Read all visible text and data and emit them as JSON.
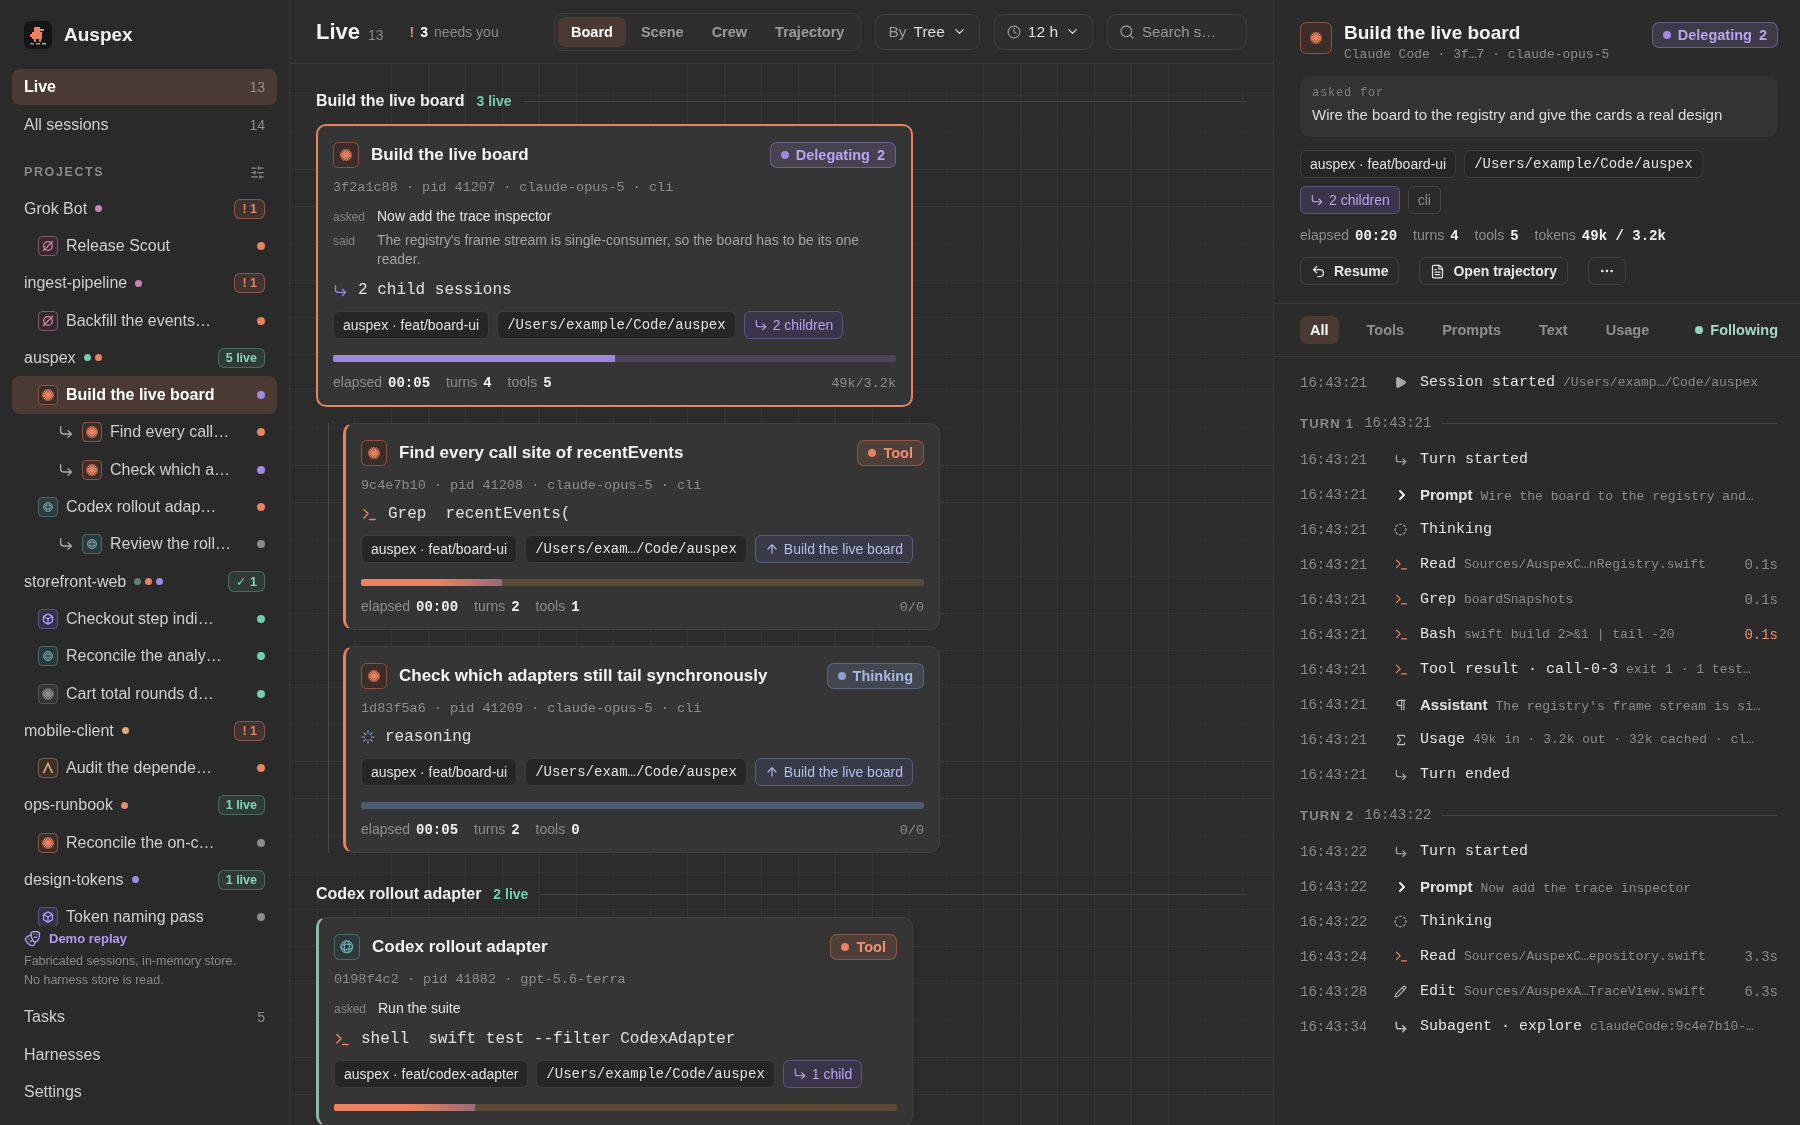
{
  "sidebar": {
    "app_name": "Auspex",
    "nav": [
      {
        "label": "Live",
        "count": "13",
        "selected": true
      },
      {
        "label": "All sessions",
        "count": "14",
        "selected": false
      }
    ],
    "projects_heading": "PROJECTS",
    "projects": [
      {
        "name": "Grok Bot",
        "dots": [
          {
            "color": "#c587b0"
          }
        ],
        "badge": {
          "kind": "alert",
          "text": "! 1"
        },
        "sessions": [
          {
            "title": "Release Scout",
            "kind": "grok",
            "color": "#e8825f",
            "selected": false
          }
        ]
      },
      {
        "name": "ingest-pipeline",
        "dots": [
          {
            "color": "#c587b0"
          }
        ],
        "badge": {
          "kind": "alert",
          "text": "! 1"
        },
        "sessions": [
          {
            "title": "Backfill the events…",
            "kind": "grok",
            "color": "#e8825f",
            "selected": false
          }
        ]
      },
      {
        "name": "auspex",
        "dots": [
          {
            "color": "#6fcfb0"
          },
          {
            "color": "#e8825f"
          }
        ],
        "badge": {
          "kind": "live",
          "text": "5 live"
        },
        "sessions": [
          {
            "title": "Build the live board",
            "kind": "claude",
            "color": "#a08ae0",
            "selected": true,
            "children": [
              {
                "title": "Find every call…",
                "kind": "claude",
                "color": "#e8825f",
                "selected": false
              },
              {
                "title": "Check which a…",
                "kind": "claude",
                "color": "#a08ae0",
                "selected": false
              }
            ]
          },
          {
            "title": "Codex rollout adap…",
            "kind": "codex",
            "color": "#e8825f",
            "selected": false,
            "children": [
              {
                "title": "Review the roll…",
                "kind": "codex",
                "color": "#8a8a8a",
                "selected": false
              }
            ]
          }
        ]
      },
      {
        "name": "storefront-web",
        "dots": [
          {
            "color": "#5f7f78"
          },
          {
            "color": "#e8825f"
          },
          {
            "color": "#a08ae0"
          }
        ],
        "badge": {
          "kind": "done",
          "text": "✓ 1"
        },
        "sessions": [
          {
            "title": "Checkout step indi…",
            "kind": "cube",
            "color": "#6fcfb0",
            "selected": false
          },
          {
            "title": "Reconcile the analy…",
            "kind": "codex",
            "color": "#6fcfb0",
            "selected": false
          },
          {
            "title": "Cart total rounds d…",
            "kind": "spark",
            "color": "#6fcfb0",
            "selected": false
          }
        ]
      },
      {
        "name": "mobile-client",
        "dots": [
          {
            "color": "#e0a878"
          }
        ],
        "badge": {
          "kind": "alert",
          "text": "! 1"
        },
        "sessions": [
          {
            "title": "Audit the depende…",
            "kind": "peak",
            "color": "#e8825f",
            "selected": false
          }
        ]
      },
      {
        "name": "ops-runbook",
        "dots": [
          {
            "color": "#e0906a"
          }
        ],
        "badge": {
          "kind": "live",
          "text": "1 live"
        },
        "sessions": [
          {
            "title": "Reconcile the on-c…",
            "kind": "claude",
            "color": "#8a8a8a",
            "selected": false
          }
        ]
      },
      {
        "name": "design-tokens",
        "dots": [
          {
            "color": "#a08ae0"
          }
        ],
        "badge": {
          "kind": "live",
          "text": "1 live"
        },
        "sessions": [
          {
            "title": "Token naming pass",
            "kind": "cube",
            "color": "#8a8a8a",
            "selected": false
          }
        ]
      }
    ],
    "demo": {
      "title": "Demo replay",
      "lines": [
        "Fabricated sessions, in-memory store.",
        "No harness store is read."
      ]
    },
    "footer": [
      {
        "label": "Tasks",
        "count": "5"
      },
      {
        "label": "Harnesses"
      },
      {
        "label": "Settings"
      }
    ]
  },
  "main": {
    "title": "Live",
    "count": "13",
    "attention": {
      "mark": "!",
      "count": "3",
      "label": "needs you"
    },
    "views": [
      {
        "label": "Board",
        "selected": true
      },
      {
        "label": "Scene",
        "selected": false
      },
      {
        "label": "Crew",
        "selected": false
      },
      {
        "label": "Trajectory",
        "selected": false
      }
    ],
    "group_by": {
      "label": "By",
      "value": "Tree"
    },
    "range": {
      "value": "12 h"
    },
    "search": {
      "placeholder": "Search s…"
    },
    "groups": [
      {
        "title": "Build the live board",
        "live": "3 live",
        "cards": [
          {
            "title": "Build the live board",
            "kind": "claude",
            "selected": true,
            "color": "#e8825f",
            "status": {
              "kind": "delegating",
              "label": "Delegating",
              "count": "2"
            },
            "meta": "3f2a1c88 · pid 41207 · claude-opus-5 · cli",
            "asked_label": "asked",
            "asked": "Now add the trace inspector",
            "said_label": "said",
            "said": "The registry's frame stream is single-consumer, so the board has to be its one reader.",
            "activity": {
              "kind": "children",
              "text": "2 child sessions"
            },
            "tags": [
              {
                "kind": "branch",
                "text": "auspex · feat/board-ui"
              },
              {
                "kind": "path",
                "text": "/Users/example/Code/auspex"
              },
              {
                "kind": "children",
                "text": "2 children"
              }
            ],
            "progress": {
              "kind": "delegating",
              "level": 0.5
            },
            "stats": [
              {
                "label": "elapsed",
                "value": "00:05"
              },
              {
                "label": "turns",
                "value": "4"
              },
              {
                "label": "tools",
                "value": "5"
              }
            ],
            "tokens": "49k/3.2k",
            "children": [
              {
                "title": "Find every call site of recentEvents",
                "kind": "claude",
                "selected": false,
                "color": "#e8825f",
                "status": {
                  "kind": "tool",
                  "label": "Tool"
                },
                "meta": "9c4e7b10 · pid 41208 · claude-opus-5 · cli",
                "activity": {
                  "kind": "command",
                  "tool": "Grep",
                  "text": "recentEvents("
                },
                "tags": [
                  {
                    "kind": "branch",
                    "text": "auspex · feat/board-ui"
                  },
                  {
                    "kind": "path",
                    "text": "/Users/exam…/Code/auspex"
                  },
                  {
                    "kind": "parent",
                    "text": "Build the live board"
                  }
                ],
                "progress": {
                  "kind": "tool",
                  "level": 0.25
                },
                "stats": [
                  {
                    "label": "elapsed",
                    "value": "00:00"
                  },
                  {
                    "label": "turns",
                    "value": "2"
                  },
                  {
                    "label": "tools",
                    "value": "1"
                  }
                ],
                "tokens": "0/0"
              },
              {
                "title": "Check which adapters still tail synchronously",
                "kind": "claude",
                "selected": false,
                "color": "#e8825f",
                "status": {
                  "kind": "thinking",
                  "label": "Thinking"
                },
                "meta": "1d83f5a6 · pid 41209 · claude-opus-5 · cli",
                "activity": {
                  "kind": "reasoning",
                  "text": "reasoning"
                },
                "tags": [
                  {
                    "kind": "branch",
                    "text": "auspex · feat/board-ui"
                  },
                  {
                    "kind": "path",
                    "text": "/Users/exam…/Code/auspex"
                  },
                  {
                    "kind": "parent",
                    "text": "Build the live board"
                  }
                ],
                "progress": {
                  "kind": "thinking",
                  "level": 1
                },
                "stats": [
                  {
                    "label": "elapsed",
                    "value": "00:05"
                  },
                  {
                    "label": "turns",
                    "value": "2"
                  },
                  {
                    "label": "tools",
                    "value": "0"
                  }
                ],
                "tokens": "0/0"
              }
            ]
          }
        ]
      },
      {
        "title": "Codex rollout adapter",
        "live": "2 live",
        "cards": [
          {
            "title": "Codex rollout adapter",
            "kind": "codex",
            "selected": false,
            "color": "#8fb8a4",
            "status": {
              "kind": "tool",
              "label": "Tool"
            },
            "meta": "0198f4c2 · pid 41882 · gpt-5.6-terra",
            "asked_label": "asked",
            "asked": "Run the suite",
            "activity": {
              "kind": "command",
              "tool": "shell",
              "text": "swift test --filter CodexAdapter"
            },
            "tags": [
              {
                "kind": "branch",
                "text": "auspex · feat/codex-adapter"
              },
              {
                "kind": "path",
                "text": "/Users/example/Code/auspex"
              },
              {
                "kind": "children",
                "text": "1 child"
              }
            ],
            "progress": {
              "kind": "tool",
              "level": 0.25
            }
          }
        ]
      }
    ]
  },
  "detail": {
    "title": "Build the live board",
    "kind": "claude",
    "subtitle": "Claude Code · 3f…7 · claude-opus-5",
    "status": {
      "kind": "delegating",
      "label": "Delegating",
      "count": "2"
    },
    "asked_label": "asked for",
    "asked": "Wire the board to the registry and give the cards a real design",
    "tags": [
      {
        "kind": "branch",
        "text": "auspex · feat/board-ui"
      },
      {
        "kind": "path",
        "text": "/Users/example/Code/auspex"
      },
      {
        "kind": "children",
        "text": "2 children"
      },
      {
        "kind": "plain",
        "text": "cli"
      }
    ],
    "stats": [
      {
        "label": "elapsed",
        "value": "00:20"
      },
      {
        "label": "turns",
        "value": "4"
      },
      {
        "label": "tools",
        "value": "5"
      },
      {
        "label": "tokens",
        "value": "49k / 3.2k"
      }
    ],
    "actions": [
      {
        "kind": "resume",
        "label": "Resume"
      },
      {
        "kind": "trajectory",
        "label": "Open trajectory"
      },
      {
        "kind": "more"
      }
    ],
    "filters": [
      {
        "label": "All",
        "selected": true
      },
      {
        "label": "Tools",
        "selected": false
      },
      {
        "label": "Prompts",
        "selected": false
      },
      {
        "label": "Text",
        "selected": false
      },
      {
        "label": "Usage",
        "selected": false
      }
    ],
    "following": {
      "label": "Following",
      "on": true
    },
    "log": [
      {
        "kind": "play",
        "time": "16:43:21",
        "label": "Session started",
        "detail": "/Users/examp…/Code/auspex"
      },
      {
        "kind": "turn_header",
        "label": "TURN 1",
        "time": "16:43:21"
      },
      {
        "kind": "turn",
        "time": "16:43:21",
        "label": "Turn started"
      },
      {
        "kind": "prompt",
        "time": "16:43:21",
        "label": "Prompt",
        "detail": "Wire the board to the registry and…"
      },
      {
        "kind": "thinking",
        "time": "16:43:21",
        "label": "Thinking"
      },
      {
        "kind": "tool",
        "time": "16:43:21",
        "label": "Read",
        "detail": "Sources/AuspexC…nRegistry.swift",
        "duration": "0.1s",
        "slow": false
      },
      {
        "kind": "tool",
        "time": "16:43:21",
        "label": "Grep",
        "detail": "boardSnapshots",
        "duration": "0.1s",
        "slow": false
      },
      {
        "kind": "tool",
        "time": "16:43:21",
        "label": "Bash",
        "detail": "swift build 2>&1 | tail -20",
        "duration": "0.1s",
        "slow": true
      },
      {
        "kind": "tool",
        "time": "16:43:21",
        "label": "Tool result · call-0-3",
        "detail": "exit 1 · 1 test…"
      },
      {
        "kind": "assistant",
        "time": "16:43:21",
        "label": "Assistant",
        "detail": "The registry's frame stream is si…"
      },
      {
        "kind": "usage",
        "time": "16:43:21",
        "label": "Usage",
        "detail": "49k in · 3.2k out · 32k cached · cl…"
      },
      {
        "kind": "turn",
        "time": "16:43:21",
        "label": "Turn ended"
      },
      {
        "kind": "turn_header",
        "label": "TURN 2",
        "time": "16:43:22"
      },
      {
        "kind": "turn",
        "time": "16:43:22",
        "label": "Turn started"
      },
      {
        "kind": "prompt",
        "time": "16:43:22",
        "label": "Prompt",
        "detail": "Now add the trace inspector"
      },
      {
        "kind": "thinking",
        "time": "16:43:22",
        "label": "Thinking"
      },
      {
        "kind": "tool",
        "time": "16:43:24",
        "label": "Read",
        "detail": "Sources/AuspexC…epository.swift",
        "duration": "3.3s",
        "slow": false
      },
      {
        "kind": "edit",
        "time": "16:43:28",
        "label": "Edit",
        "detail": "Sources/AuspexA…TraceView.swift",
        "duration": "6.3s",
        "slow": false
      },
      {
        "kind": "subagent",
        "time": "16:43:34",
        "label": "Subagent · explore",
        "detail": "claudeCode:9c4e7b10-…"
      }
    ]
  }
}
